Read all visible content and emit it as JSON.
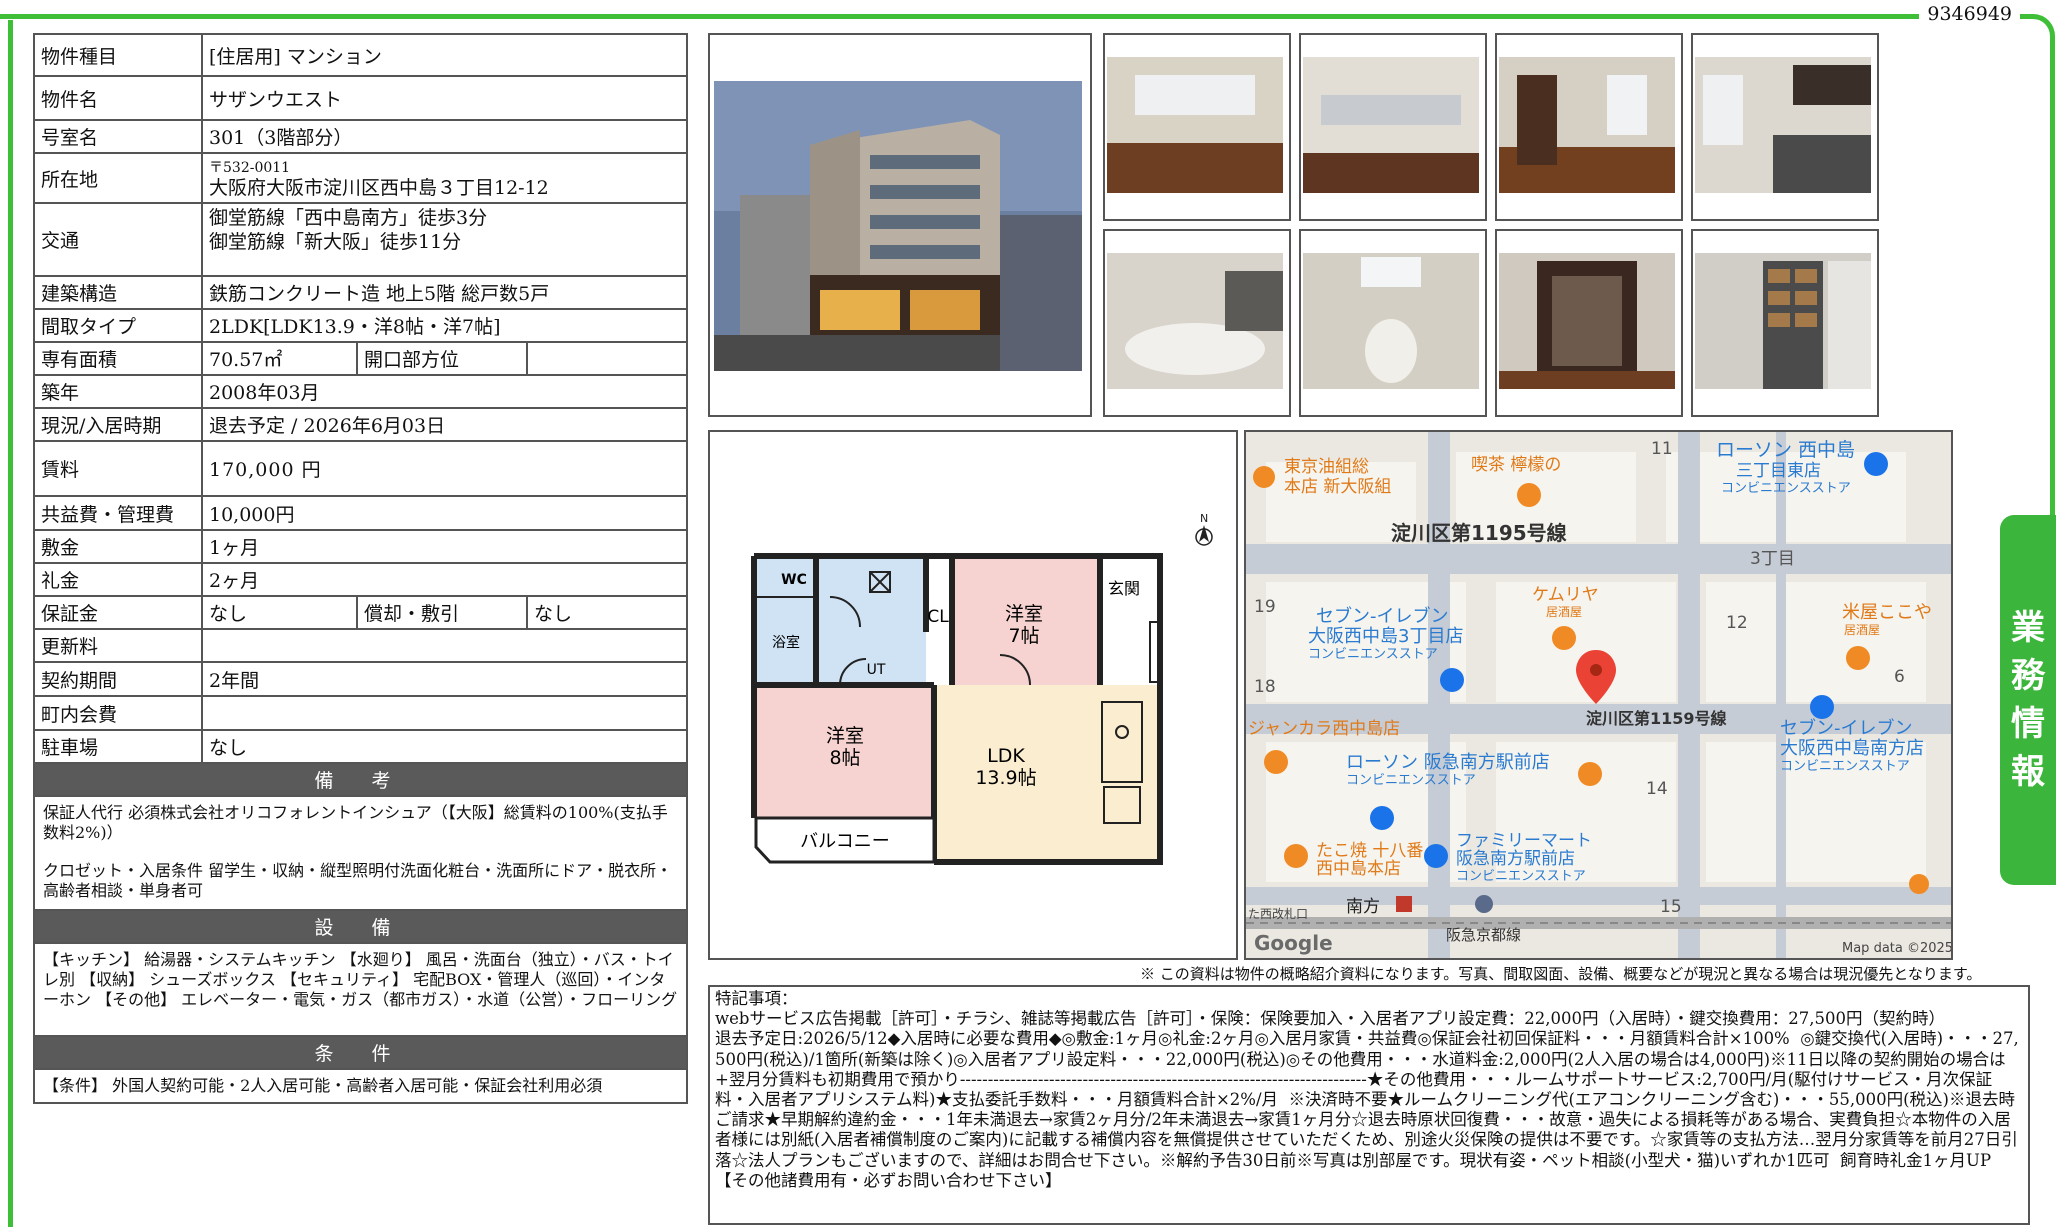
{
  "doc_id": "9346949",
  "side_tab": [
    "業",
    "務",
    "情",
    "報"
  ],
  "info": {
    "type_label": "物件種目",
    "type_value": "[住居用]  マンション",
    "name_label": "物件名",
    "name_value": "サザンウエスト",
    "room_label": "号室名",
    "room_value": "301（3階部分）",
    "address_label": "所在地",
    "postal": "〒532-0011",
    "address": "大阪府大阪市淀川区西中島３丁目12-12",
    "access_label": "交通",
    "access_1": "御堂筋線「西中島南方」徒歩3分",
    "access_2": "御堂筋線「新大阪」徒歩11分",
    "structure_label": "建築構造",
    "structure_value": "鉄筋コンクリート造  地上5階  総戸数5戸",
    "layout_label": "間取タイプ",
    "layout_value": "2LDK[LDK13.9・洋8帖・洋7帖]",
    "area_label": "専有面積",
    "area_value": "70.57㎡",
    "direction_label": "開口部方位",
    "direction_value": "",
    "built_label": "築年",
    "built_value": "2008年03月",
    "status_label": "現況/入居時期",
    "status_value": "退去予定  /  2026年6月03日",
    "rent_label": "賃料",
    "rent_value": "170,000 円",
    "fee_label": "共益費・管理費",
    "fee_value": "10,000円",
    "deposit_label": "敷金",
    "deposit_value": "1ヶ月",
    "key_money_label": "礼金",
    "key_money_value": "2ヶ月",
    "guarantee_label": "保証金",
    "guarantee_value": "なし",
    "amort_label": "償却・敷引",
    "amort_value": "なし",
    "renewal_label": "更新料",
    "renewal_value": "",
    "contract_label": "契約期間",
    "contract_value": "2年間",
    "town_label": "町内会費",
    "town_value": "",
    "parking_label": "駐車場",
    "parking_value": "なし"
  },
  "remarks": {
    "heading": "備 考",
    "text_1": "保証人代行  必須株式会社オリコフォレントインシュア（【大阪】総賃料の100%(支払手数料2%)）",
    "text_2": "クロゼット・入居条件  留学生・収納・縦型照明付洗面化粧台・洗面所にドア・脱衣所・高齢者相談・単身者可"
  },
  "facilities": {
    "heading": "設 備",
    "text": "【キッチン】 給湯器・システムキッチン  【水廻り】 風呂・洗面台（独立）・バス・トイレ別  【収納】 シューズボックス  【セキュリティ】 宅配BOX・管理人（巡回）・インターホン  【その他】 エレベーター・電気・ガス（都市ガス）・水道（公営）・フローリング"
  },
  "conditions": {
    "heading": "条 件",
    "text": "【条件】  外国人契約可能・2人入居可能・高齢者入居可能・保証会社利用必須"
  },
  "floorplan": {
    "wc": "WC",
    "bath": "浴室",
    "ut": "UT",
    "cl": "CL",
    "genkan": "玄関",
    "room1_name": "洋室",
    "room1_size": "7帖",
    "room2_name": "洋室",
    "room2_size": "8帖",
    "ldk_name": "LDK",
    "ldk_size": "13.9帖",
    "balcony": "バルコニー",
    "north": "N"
  },
  "map": {
    "street_1": "淀川区第1195号線",
    "street_2": "淀川区第1159号線",
    "poi_1a": "東京油組総",
    "poi_1b": "本店 新大阪組",
    "poi_2": "喫茶 檸檬の",
    "poi_3a": "ローソン 西中島",
    "poi_3b": "三丁目東店",
    "poi_3c": "コンビニエンスストア",
    "poi_4a": "ケムリヤ",
    "poi_4b": "居酒屋",
    "poi_5a": "セブン-イレブン",
    "poi_5b": "大阪西中島3丁目店",
    "poi_5c": "コンビニエンスストア",
    "poi_6a": "米屋ここや",
    "poi_6b": "居酒屋",
    "poi_7": "ジャンカラ西中島店",
    "poi_8a": "ローソン 阪急南方駅前店",
    "poi_8b": "コンビニエンスストア",
    "poi_9a": "セブン-イレブン",
    "poi_9b": "大阪西中島南方店",
    "poi_9c": "コンビニエンスストア",
    "poi_10a": "たこ焼 十八番",
    "poi_10b": "西中島本店",
    "poi_11a": "ファミリーマート",
    "poi_11b": "阪急南方駅前店",
    "poi_11c": "コンビニエンスストア",
    "poi_12": "南方",
    "poi_13": "阪急京都線",
    "poi_14": "た西改札口",
    "block_11": "11",
    "block_3": "3丁目",
    "block_19": "19",
    "block_12": "12",
    "block_18": "18",
    "block_6": "6",
    "block_14": "14",
    "block_15": "15",
    "google": "Google",
    "copyright": "Map data ©2025"
  },
  "disclaimer": "※ この資料は物件の概略紹介資料になります。写真、間取図面、設備、概要などが現況と異なる場合は現況優先となります。",
  "notes": {
    "heading": "特記事項：",
    "body": "webサービス広告掲載［許可］・チラシ、雑誌等掲載広告［許可］・保険：保険要加入・入居者アプリ設定費：22,000円（入居時）・鍵交換費用：27,500円（契約時）\n退去予定日:2026/5/12◆入居時に必要な費用◆◎敷金:1ヶ月◎礼金:2ヶ月◎入居月家賃・共益費◎保証会社初回保証料・・・月額賃料合計×100%  ◎鍵交換代(入居時)・・・27,500円(税込)/1箇所(新築は除く)◎入居者アプリ設定料・・・22,000円(税込)◎その他費用・・・水道料金:2,000円(2人入居の場合は4,000円)※11日以降の契約開始の場合は+翌月分賃料も初期費用で預かり-------------------------------------------------------------------------★その他費用・・・ルームサポートサービス:2,700円/月(駆付けサービス・月次保証料・入居者アプリシステム料)★支払委託手数料・・・月額賃料合計×2%/月  ※決済時不要★ルームクリーニング代(エアコンクリーニング含む)・・・55,000円(税込)※退去時ご請求★早期解約違約金・・・1年未満退去→家賃2ヶ月分/2年未満退去→家賃1ヶ月分☆退去時原状回復費・・・故意・過失による損耗等がある場合、実費負担☆本物件の入居者様には別紙(入居者補償制度のご案内)に記載する補償内容を無償提供させていただくため、別途火災保険の提供は不要です。☆家賃等の支払方法…翌月分家賃等を前月27日引落☆法人プランもございますので、詳細はお問合せ下さい。※解約予告30日前※写真は別部屋です。現状有姿・ペット相談(小型犬・猫)いずれか1匹可  飼育時礼金1ヶ月UP【その他諸費用有・必ずお問い合わせ下さい】"
  },
  "colors": {
    "frame": "#3fbf38",
    "side_tab": "#3bb53b",
    "section_head": "#5a5a5a"
  }
}
